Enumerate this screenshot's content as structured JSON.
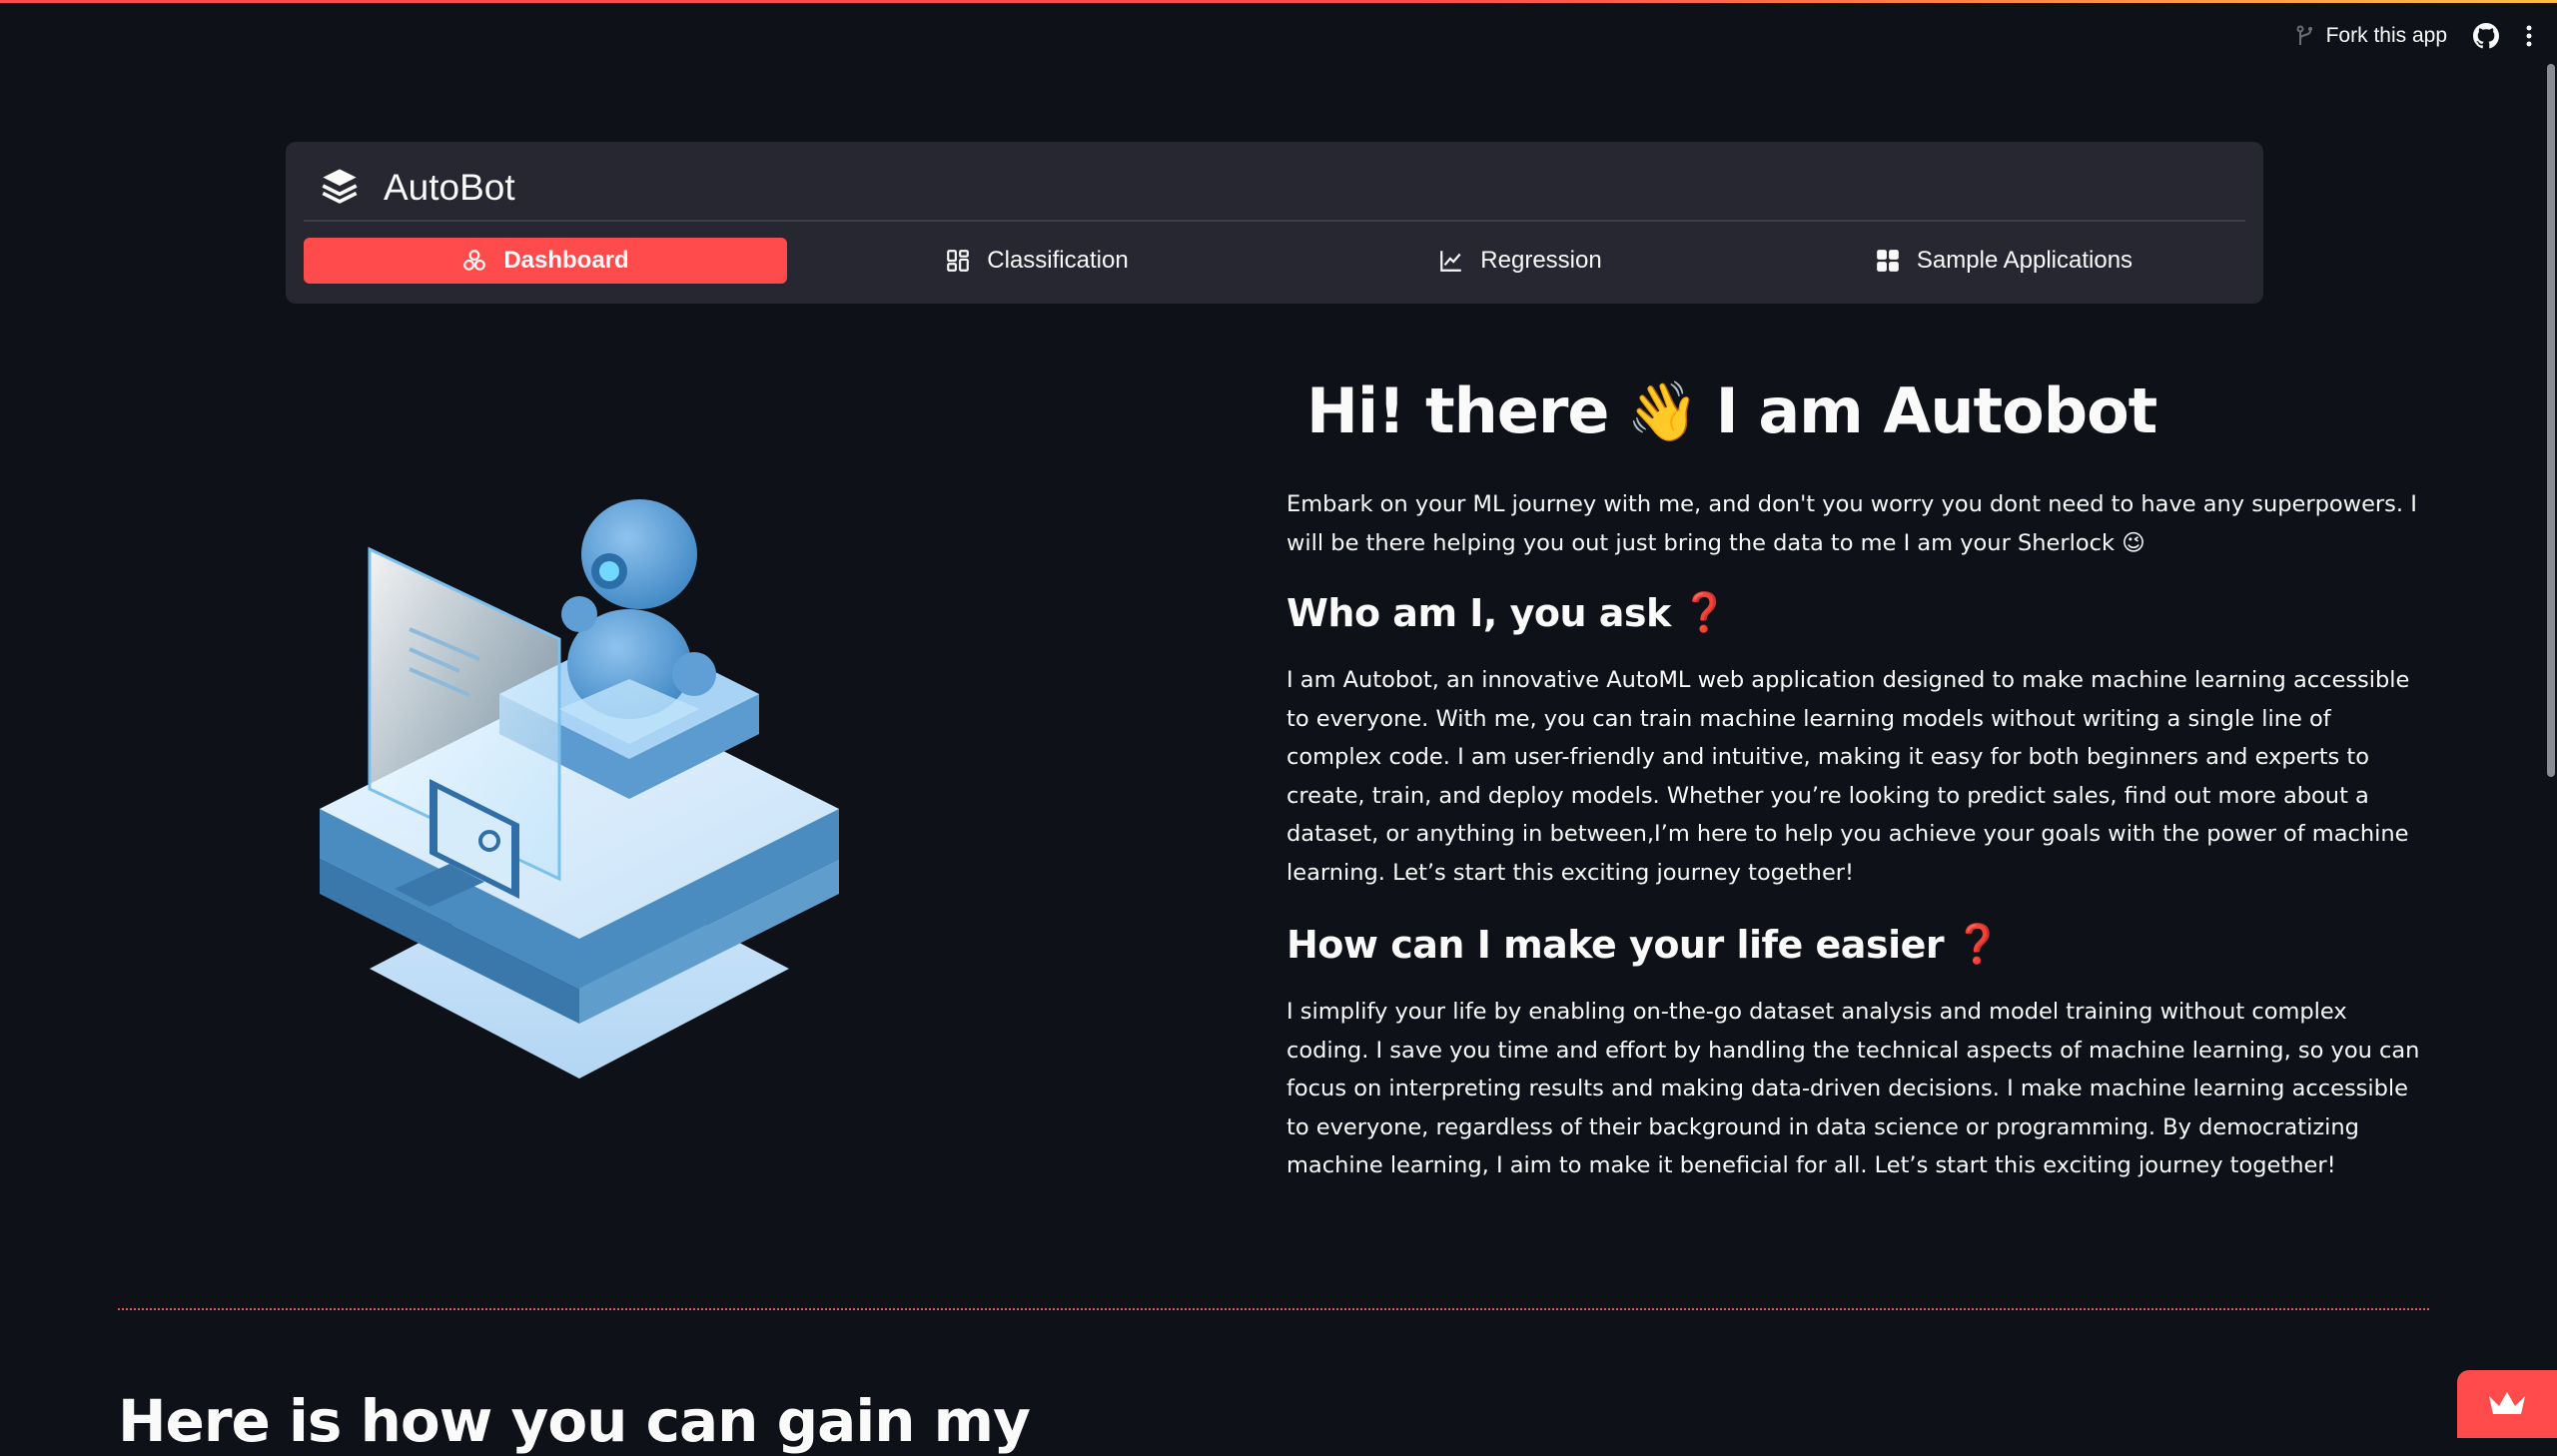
{
  "toolbar": {
    "fork_label": "Fork this app"
  },
  "nav": {
    "brand": "AutoBot",
    "tabs": [
      {
        "label": "Dashboard",
        "active": true,
        "icon": "grid-circles-icon"
      },
      {
        "label": "Classification",
        "active": false,
        "icon": "classification-icon"
      },
      {
        "label": "Regression",
        "active": false,
        "icon": "line-chart-icon"
      },
      {
        "label": "Sample Applications",
        "active": false,
        "icon": "apps-grid-icon"
      }
    ]
  },
  "main": {
    "hero_title_part1": "Hi! there",
    "hero_emoji": "👋",
    "hero_title_part2": "I am Autobot",
    "intro": "Embark on your ML journey with me, and don't you worry you dont need to have any superpowers. I will be there helping you out just bring the data to me I am your Sherlock",
    "intro_emoji": "😉",
    "who_heading": "Who am I, you ask",
    "who_text": "I am Autobot, an innovative AutoML web application designed to make machine learning accessible to everyone. With me, you can train machine learning models without writing a single line of complex code. I am user-friendly and intuitive, making it easy for both beginners and experts to create, train, and deploy models. Whether you’re looking to predict sales, find out more about a dataset, or anything in between,I’m here to help you achieve your goals with the power of machine learning. Let’s start this exciting journey together!",
    "how_heading": "How can I make your life easier",
    "how_text": "I simplify your life by enabling on-the-go dataset analysis and model training without complex coding. I save you time and effort by handling the technical aspects of machine learning, so you can focus on interpreting results and making data-driven decisions. I make machine learning accessible to everyone, regardless of their background in data science or programming. By democratizing machine learning, I aim to make it beneficial for all. Let’s start this exciting journey together!",
    "question_mark": "❓",
    "bottom_heading": "Here is how you can gain my"
  },
  "colors": {
    "background": "#0e1117",
    "card": "#262730",
    "accent": "#ff4b4b",
    "text": "#fafafa"
  }
}
